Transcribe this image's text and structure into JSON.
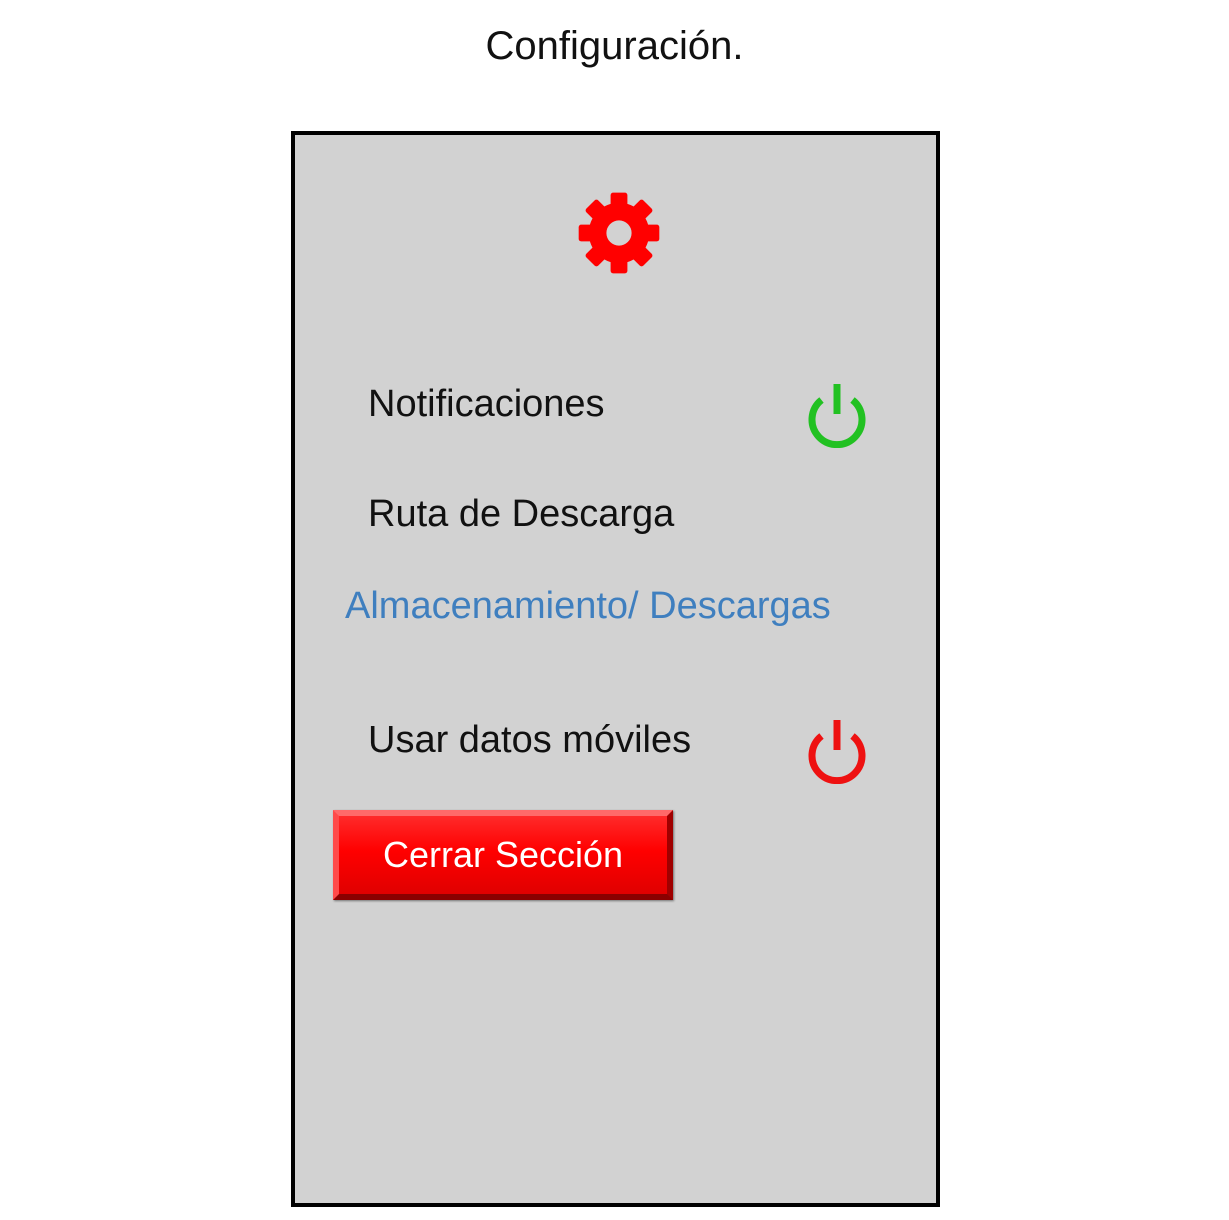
{
  "page": {
    "title": "Configuración."
  },
  "settings": {
    "notifications": {
      "label": "Notificaciones",
      "icon": "power-icon",
      "state": "on",
      "color": "#22c122"
    },
    "download_path": {
      "label": "Ruta de Descarga",
      "value": "Almacenamiento/ Descargas",
      "link_color": "#3f7fbf"
    },
    "mobile_data": {
      "label": "Usar datos móviles",
      "icon": "power-icon",
      "state": "off",
      "color": "#ee1111"
    }
  },
  "header": {
    "icon": "gear-icon",
    "icon_color": "#ff0000"
  },
  "actions": {
    "logout_label": "Cerrar Sección",
    "logout_color": "#ff0000"
  },
  "colors": {
    "frame_background": "#d2d2d2",
    "frame_border": "#000000"
  }
}
